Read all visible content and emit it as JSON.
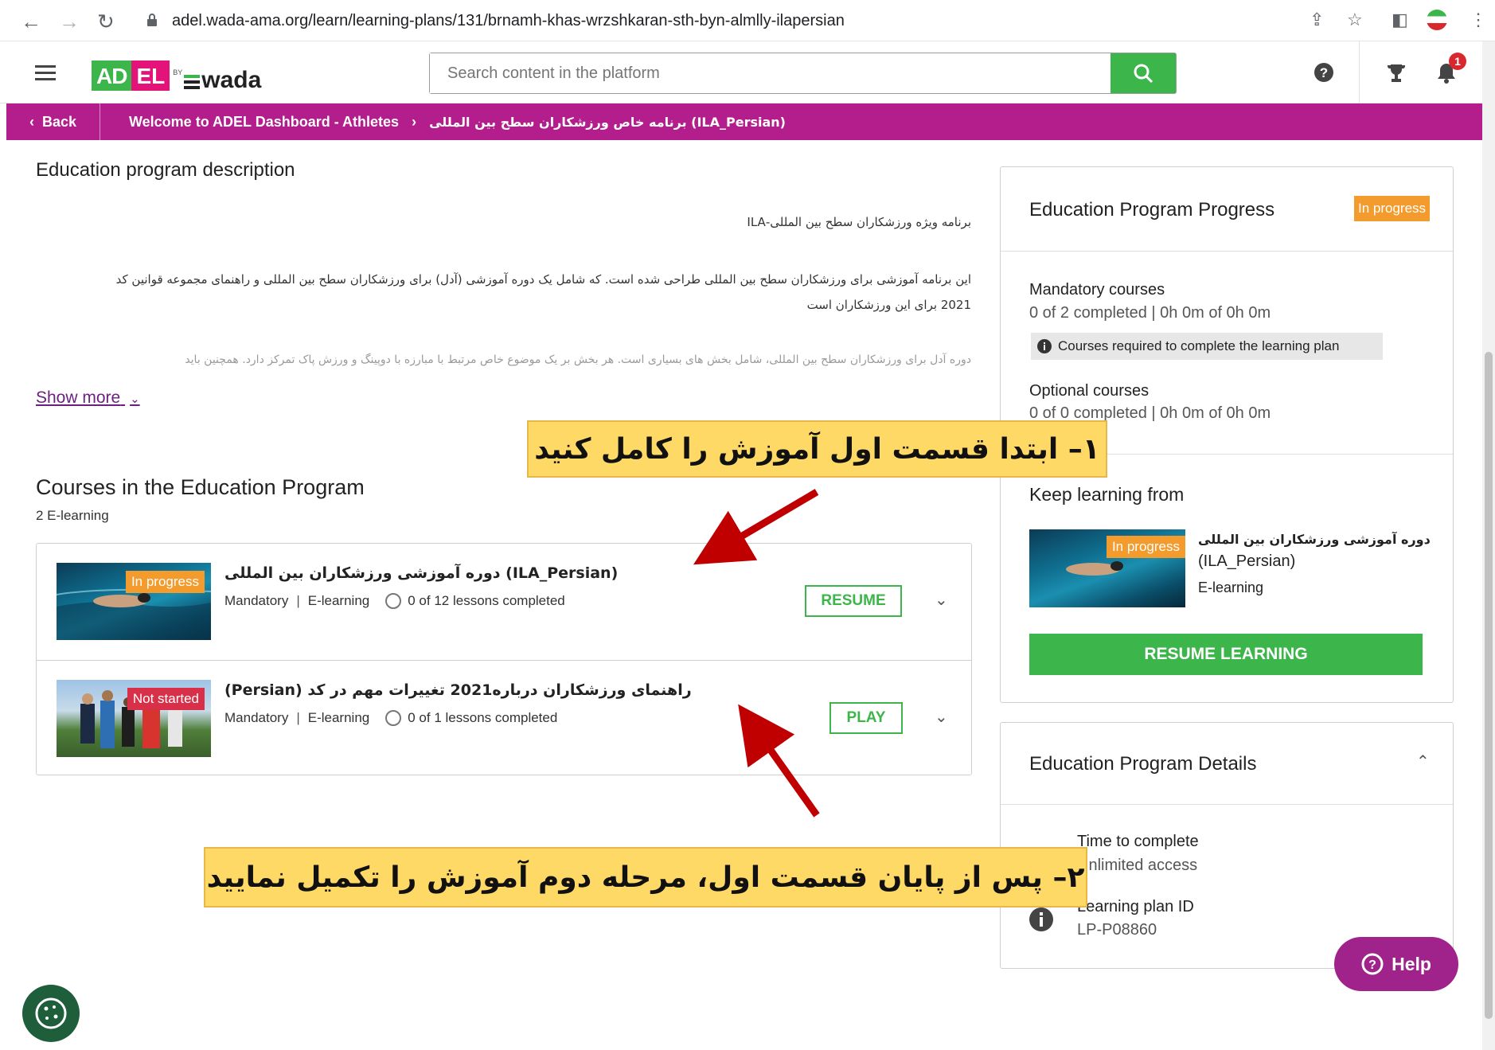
{
  "browser": {
    "url": "adel.wada-ama.org/learn/learning-plans/131/brnamh-khas-wrzshkaran-sth-byn-almlly-ilapersian"
  },
  "header": {
    "logo_adel_ad": "AD",
    "logo_adel_el": "EL",
    "logo_by": "BY",
    "logo_wada": "wada",
    "search_placeholder": "Search content in the platform",
    "notification_count": "1"
  },
  "breadcrumb": {
    "back": "Back",
    "item1": "Welcome to ADEL Dashboard - Athletes",
    "item2": "برنامه خاص ورزشکاران سطح بین المللی (ILA_Persian)"
  },
  "description": {
    "heading": "Education program description",
    "line1": "برنامه ویژه ورزشکاران سطح بین المللی-ILA",
    "line2": "این برنامه آموزشی برای ورزشکاران سطح بین المللی طراحی شده است. که شامل یک دوره آموزشی (آدل) برای ورزشکاران سطح بین المللی و راهنمای مجموعه قوانین کد",
    "line3": "2021 برای این ورزشکاران است",
    "line4": "دوره آدل برای ورزشکاران سطح بین المللی، شامل بخش های بسیاری است. هر بخش بر یک موضوع خاص مرتبط با مبارزه با دوپینگ و ورزش پاک تمرکز دارد. همچنین باید",
    "show_more": "Show more"
  },
  "courses": {
    "heading": "Courses in the Education Program",
    "subheading": "2 E-learning",
    "items": [
      {
        "status": "In progress",
        "title": "دوره آموزشی ورزشکاران بین المللی (ILA_Persian)",
        "type1": "Mandatory",
        "type2": "E-learning",
        "progress": "0 of 12 lessons completed",
        "action": "RESUME"
      },
      {
        "status": "Not started",
        "title": "(Persian) راهنمای ورزشکاران درباره2021 تغییرات مهم در کد",
        "type1": "Mandatory",
        "type2": "E-learning",
        "progress": "0 of 1 lessons completed",
        "action": "PLAY"
      }
    ]
  },
  "progress_panel": {
    "title": "Education Program Progress",
    "status": "In progress",
    "mandatory_label": "Mandatory courses",
    "mandatory_value": "0 of 2 completed | 0h 0m of 0h 0m",
    "required_note": "Courses required to complete the learning plan",
    "optional_label": "Optional courses",
    "optional_value": "0 of 0 completed | 0h 0m of 0h 0m",
    "keep_learning": "Keep learning from",
    "keep_status": "In progress",
    "keep_title_fa": "دوره آموزشی ورزشکاران بین المللی",
    "keep_title_en": "(ILA_Persian)",
    "keep_type": "E-learning",
    "resume_button": "RESUME LEARNING"
  },
  "details_panel": {
    "title": "Education Program Details",
    "time_label": "Time to complete",
    "time_value": "Unlimited access",
    "id_label": "Learning plan ID",
    "id_value": "LP-P08860"
  },
  "help_button": "Help",
  "callouts": {
    "first": "۱– ابتدا قسمت اول آموزش را کامل کنید",
    "second": "۲– پس از پایان قسمت اول، مرحله دوم آموزش را تکمیل نمایید"
  },
  "colors": {
    "brand_green": "#3cb54a",
    "brand_purple": "#b31d8c",
    "status_orange": "#f39b2d",
    "status_red": "#d9304a",
    "callout_yellow": "#ffd966",
    "arrow_red": "#c00000"
  }
}
